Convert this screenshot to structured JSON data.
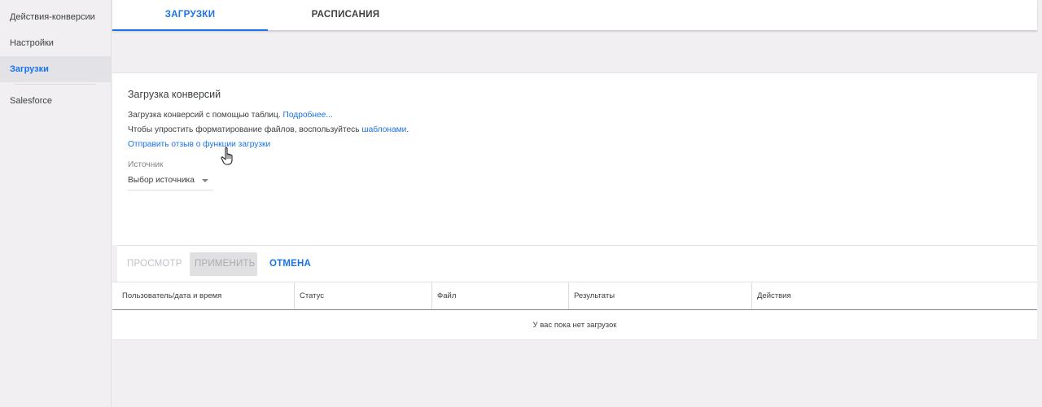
{
  "sidebar": {
    "items": [
      {
        "label": "Действия-конверсии"
      },
      {
        "label": "Настройки"
      },
      {
        "label": "Загрузки"
      },
      {
        "label": "Salesforce"
      }
    ]
  },
  "tabs": [
    {
      "label": "ЗАГРУЗКИ"
    },
    {
      "label": "РАСПИСАНИЯ"
    }
  ],
  "card": {
    "title": "Загрузка конверсий",
    "line1_text": "Загрузка конверсий с помощью таблиц.",
    "line1_link": "Подробнее...",
    "line2_text": "Чтобы упростить форматирование файлов, воспользуйтесь",
    "line2_link": "шаблонами",
    "line2_end": ".",
    "feedback_link": "Отправить отзыв о функции загрузки",
    "source_label": "Источник",
    "source_select": "Выбор источника"
  },
  "actions": {
    "preview": "ПРОСМОТР",
    "apply": "ПРИМЕНИТЬ",
    "cancel": "ОТМЕНА"
  },
  "table": {
    "columns": [
      "Пользователь/дата и время",
      "Статус",
      "Файл",
      "Результаты",
      "Действия"
    ],
    "empty_message": "У вас пока нет загрузок"
  },
  "colors": {
    "accent": "#1a73e8",
    "background": "#f1eff1"
  },
  "icons": {
    "dropdown": "chevron-down-icon",
    "cursor": "hand-pointer-icon"
  }
}
